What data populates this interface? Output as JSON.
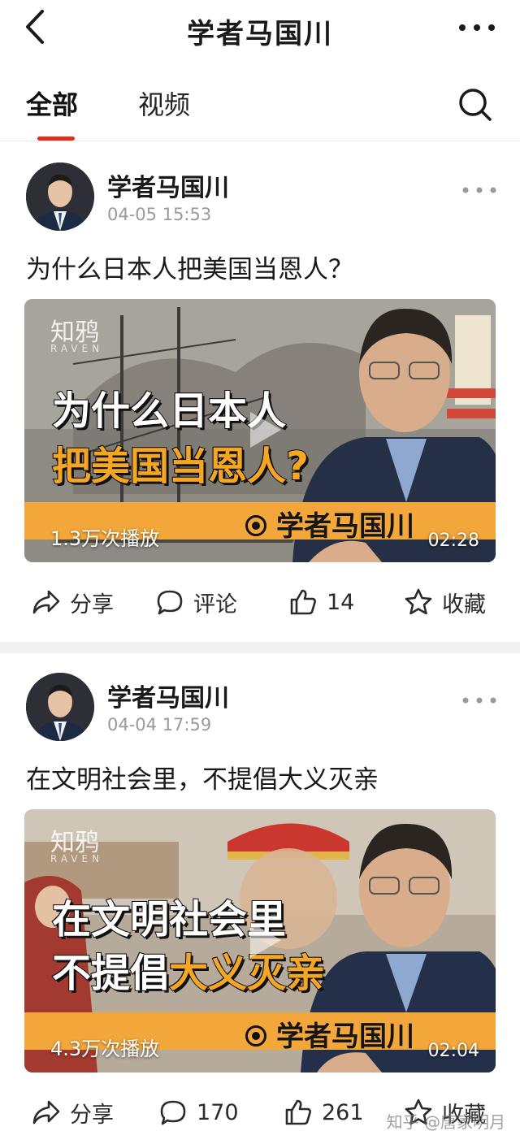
{
  "header": {
    "title": "学者马国川"
  },
  "tabs": [
    {
      "label": "全部",
      "active": true
    },
    {
      "label": "视频",
      "active": false
    }
  ],
  "colors": {
    "accent": "#e0301e",
    "caption_yellow": "#f5a623",
    "bar_orange": "#f3a63a"
  },
  "posts": [
    {
      "author": "学者马国川",
      "time": "04-05 15:53",
      "title": "为什么日本人把美国当恩人？",
      "video": {
        "brand": "知鸦",
        "brand_sub": "RAVEN",
        "caption_line1": "为什么日本人",
        "caption_line2": "把美国当恩人?",
        "badge": "学者马国川",
        "plays": "1.3万次播放",
        "duration": "02:28"
      },
      "actions": {
        "share": "分享",
        "comment": "评论",
        "like": "14",
        "favorite": "收藏"
      }
    },
    {
      "author": "学者马国川",
      "time": "04-04 17:59",
      "title": "在文明社会里，不提倡大义灭亲",
      "video": {
        "brand": "知鸦",
        "brand_sub": "RAVEN",
        "caption_line1": "在文明社会里",
        "caption_line2a": "不提倡",
        "caption_line2b": "大义灭亲",
        "badge": "学者马国川",
        "plays": "4.3万次播放",
        "duration": "02:04"
      },
      "actions": {
        "share": "分享",
        "comment": "170",
        "like": "261",
        "favorite": "收藏"
      }
    }
  ],
  "watermark": "知乎 @唐家明月"
}
